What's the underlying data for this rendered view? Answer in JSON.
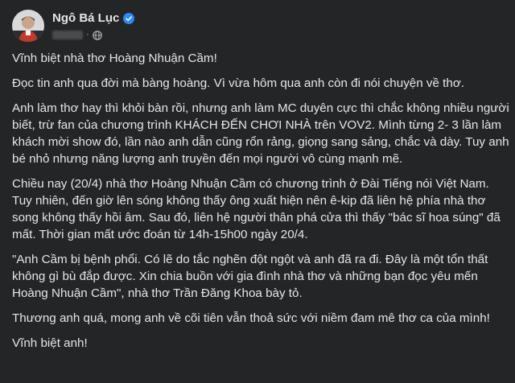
{
  "post": {
    "author_name": "Ngô Bá Lục",
    "paragraphs": [
      "Vĩnh biệt nhà thơ Hoàng Nhuận Cầm!",
      "Đọc tin anh qua đời mà bàng hoàng. Vì vừa hôm qua anh còn đi nói chuyện về thơ.",
      "Anh làm thơ hay thì khỏi bàn rồi, nhưng anh làm MC duyên cực thì chắc không nhiều người biết, trừ fan của chương trình KHÁCH ĐẾN CHƠI NHÀ trên VOV2. Mình từng 2- 3 lần làm khách mời show đó, lần nào anh dẫn cũng rổn rảng, giọng sang sảng, chắc và dày. Tuy anh bé nhỏ nhưng năng lượng anh truyền đến mọi người vô cùng mạnh mẽ.",
      "Chiều nay (20/4) nhà thơ Hoàng Nhuận Cầm có chương trình ở Đài Tiếng nói Việt Nam. Tuy nhiên, đến giờ lên sóng không thấy ông xuất hiện nên ê-kip đã liên hệ phía nhà thơ song không thấy hồi âm. Sau đó, liên hệ người thân phá cửa thì thấy \"bác sĩ hoa súng\" đã mất. Thời gian mất ước đoán từ 14h-15h00 ngày 20/4.",
      "\"Anh Cầm bị bệnh phổi. Có lẽ do tắc nghẽn đột ngột và anh đã ra đi. Đây là một tổn thất không gì bù đắp được. Xin chia buồn với gia đình nhà thơ và những bạn đọc yêu mến Hoàng Nhuận Cầm\", nhà thơ Trần Đăng Khoa bày tỏ.",
      "Thương anh quá, mong anh về cõi tiên vẫn thoả sức với niềm đam mê thơ ca của mình!",
      "Vĩnh biệt anh!"
    ]
  },
  "icons": {
    "verified": "verified-badge-icon",
    "privacy": "globe-icon"
  },
  "colors": {
    "background": "#242526",
    "text": "#e4e6eb",
    "secondary_text": "#b0b3b8",
    "verified_blue": "#2d88ff"
  }
}
